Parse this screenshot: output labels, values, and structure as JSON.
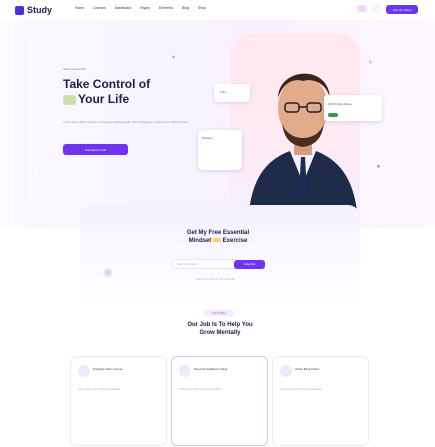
{
  "nav": {
    "brand": "Study",
    "menu": [
      "Home",
      "Courses",
      "Dashboard",
      "Pages",
      "Elements",
      "Blog",
      "Shop"
    ],
    "cta": "Join Us Today"
  },
  "hero": {
    "tag": "Talk a Life Coach",
    "title_line1": "Take Control of",
    "title_line2": "Your Life",
    "description": "Lorem ipsum dolor sit amet, consectetur adipiscing elit. Nunc id ligula ex. Lorem ipsum dolor sit amet.",
    "button": "Schedule A Call",
    "card1": "2.4k+",
    "card2_text": "100% Positive Review",
    "card3_text": "Reviews"
  },
  "newsletter": {
    "title_line1": "Get My Free Essential",
    "title_line2_a": "Mindset",
    "title_line2_b": "Exercise",
    "input_placeholder": "Enter Your Email",
    "button": "Subscribe",
    "note": "I want to subscribe to your mailing list"
  },
  "services": {
    "badge": "Our Practice",
    "title_line1": "Our Job Is To Help You",
    "title_line2": "Grow Mentally",
    "items": [
      {
        "title": "Positivity Online Course",
        "desc": "Lorem ipsum dolor sit amet consectetur."
      },
      {
        "title": "Personal Healthcare Class",
        "desc": "Lorem ipsum dolor sit amet consectetur."
      },
      {
        "title": "Online Book Library",
        "desc": "Lorem ipsum dolor sit amet consectetur."
      }
    ]
  },
  "colors": {
    "accent": "#6d34f2",
    "heading": "#241a49",
    "hero_bg": "#f7f3ff"
  }
}
